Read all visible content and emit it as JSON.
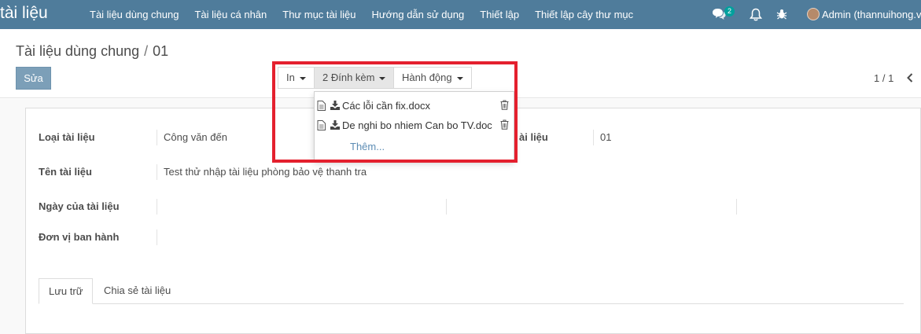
{
  "app": {
    "brand": "tài liệu"
  },
  "nav": {
    "items": [
      {
        "label": "Tài liệu dùng chung"
      },
      {
        "label": "Tài liệu cá nhân"
      },
      {
        "label": "Thư mục tài liệu"
      },
      {
        "label": "Hướng dẫn sử dụng"
      },
      {
        "label": "Thiết lập"
      },
      {
        "label": "Thiết lập cây thư mục"
      }
    ]
  },
  "systray": {
    "chat_count": "2",
    "user": "Admin (thannuihong.v"
  },
  "breadcrumb": {
    "parent": "Tài liệu dùng chung",
    "separator": "/",
    "current": "01"
  },
  "buttons": {
    "edit": "Sửa"
  },
  "sidebar": {
    "print": "In",
    "attachments": "2 Đính kèm",
    "actions": "Hành động"
  },
  "pager": {
    "value": "1 / 1"
  },
  "attachments_menu": {
    "items": [
      {
        "name": "Các lỗi cần fix.docx"
      },
      {
        "name": "De nghi bo nhiem Can bo TV.doc"
      }
    ],
    "more": "Thêm..."
  },
  "form": {
    "fields": [
      {
        "label": "Loại tài liệu",
        "value": "Công văn đến"
      },
      {
        "label": "Tên tài liệu",
        "value": "Test thử nhập tài liệu phòng bảo vệ thanh tra"
      },
      {
        "label": "Ngày của tài liệu",
        "value": ""
      },
      {
        "label": "Đơn vị ban hành",
        "value": ""
      }
    ],
    "right_field": {
      "label_fragment": "ài liệu",
      "value": "01"
    }
  },
  "tabs": [
    {
      "label": "Lưu trữ"
    },
    {
      "label": "Chia sẻ tài liệu"
    }
  ],
  "colors": {
    "navbar": "#4f7c9b",
    "edit_button": "#7c9fb8",
    "highlight": "#e4202e",
    "link": "#5c8cb4",
    "badge": "#00a09d"
  },
  "icons": [
    "chat-icon",
    "bell-icon",
    "bug-icon",
    "avatar",
    "chevron-left-icon",
    "file-icon",
    "download-icon",
    "trash-icon",
    "caret-down-icon"
  ]
}
